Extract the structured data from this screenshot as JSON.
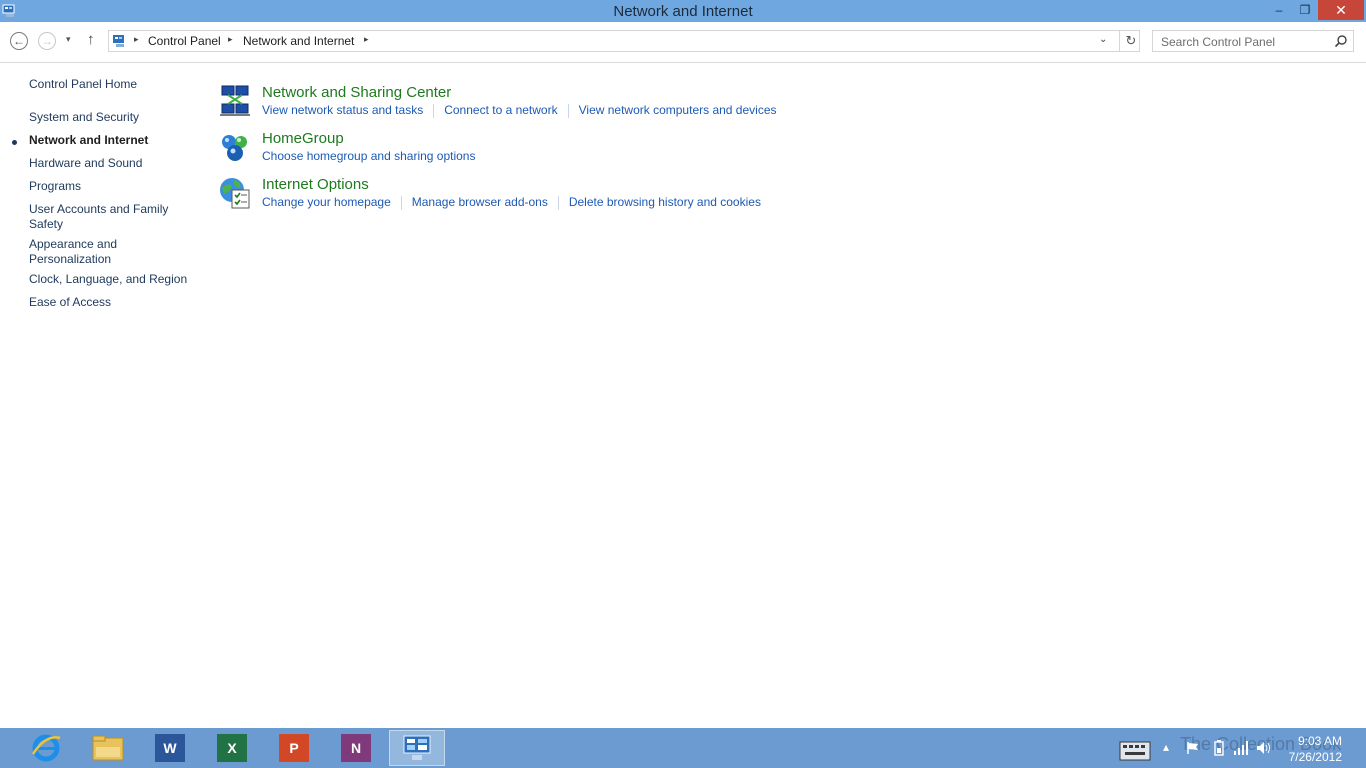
{
  "window": {
    "title": "Network and Internet",
    "min_glyph": "–",
    "max_glyph": "❐",
    "close_glyph": "✕"
  },
  "nav": {
    "back_glyph": "←",
    "forward_glyph": "→",
    "recent_glyph": "▾",
    "up_glyph": "↑",
    "breadcrumbs": [
      "Control Panel",
      "Network and Internet"
    ],
    "crumb_sep": "▸",
    "dropdown_glyph": "⌄",
    "refresh_glyph": "↻",
    "search_placeholder": "Search Control Panel"
  },
  "sidebar": {
    "items": [
      {
        "label": "Control Panel Home"
      },
      {
        "label": "System and Security"
      },
      {
        "label": "Network and Internet",
        "active": true
      },
      {
        "label": "Hardware and Sound"
      },
      {
        "label": "Programs"
      },
      {
        "label": "User Accounts and Family Safety"
      },
      {
        "label": "Appearance and Personalization"
      },
      {
        "label": "Clock, Language, and Region"
      },
      {
        "label": "Ease of Access"
      }
    ]
  },
  "categories": [
    {
      "title": "Network and Sharing Center",
      "icon": "network-sharing-icon",
      "links": [
        "View network status and tasks",
        "Connect to a network",
        "View network computers and devices"
      ]
    },
    {
      "title": "HomeGroup",
      "icon": "homegroup-icon",
      "links": [
        "Choose homegroup and sharing options"
      ]
    },
    {
      "title": "Internet Options",
      "icon": "internet-options-icon",
      "links": [
        "Change your homepage",
        "Manage browser add-ons",
        "Delete browsing history and cookies"
      ]
    }
  ],
  "taskbar": {
    "apps": [
      {
        "name": "internet-explorer",
        "icon": "ie-icon",
        "glyph": "e",
        "color": "#1a7fd4"
      },
      {
        "name": "file-explorer",
        "icon": "folder-icon",
        "glyph": "",
        "color": "#e8c25a"
      },
      {
        "name": "word",
        "icon": "word-icon",
        "glyph": "W",
        "color": "#2b579a"
      },
      {
        "name": "excel",
        "icon": "excel-icon",
        "glyph": "X",
        "color": "#217346"
      },
      {
        "name": "powerpoint",
        "icon": "powerpoint-icon",
        "glyph": "P",
        "color": "#d24726"
      },
      {
        "name": "onenote",
        "icon": "onenote-icon",
        "glyph": "N",
        "color": "#80397b"
      },
      {
        "name": "control-panel",
        "icon": "control-panel-icon",
        "glyph": "",
        "color": "#4a90d9",
        "active": true
      }
    ],
    "tray_up_glyph": "▴",
    "watermark": "The Collection Book",
    "time": "9:03 AM",
    "date": "7/26/2012"
  },
  "colors": {
    "titlebar": "#6fa8e0",
    "taskbar": "#6b9bd1",
    "category_title": "#1e7a1e",
    "link": "#1d5ab5",
    "nav_link": "#1e395b"
  }
}
